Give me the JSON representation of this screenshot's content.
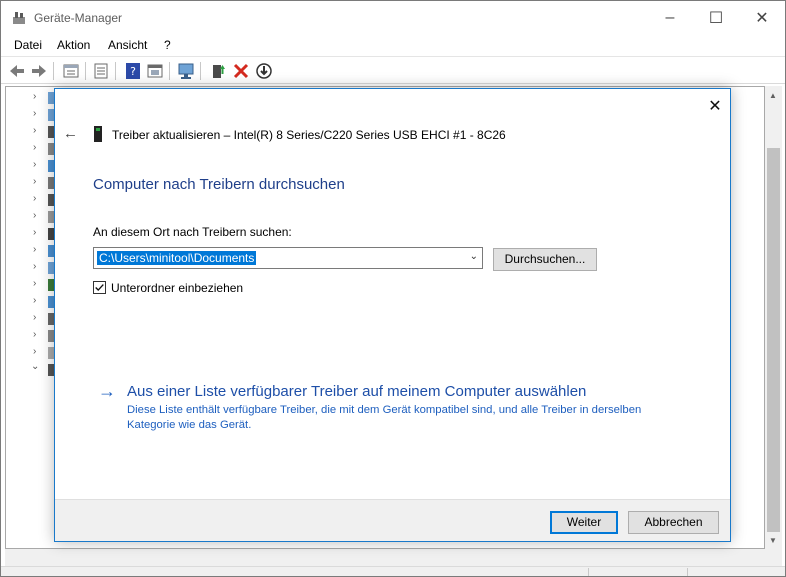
{
  "window": {
    "title": "Geräte-Manager",
    "minimize": "–",
    "maximize": "☐",
    "close": "✕"
  },
  "menu": {
    "items": [
      "Datei",
      "Aktion",
      "Ansicht",
      "?"
    ]
  },
  "toolbar": {
    "icons": [
      "back-arrow-icon",
      "forward-arrow-icon",
      "properties-icon",
      "list-icon",
      "help-icon",
      "view-icon",
      "monitor-icon",
      "add-driver-icon",
      "remove-icon",
      "download-icon"
    ]
  },
  "dialog": {
    "close": "✕",
    "back": "←",
    "title": "Treiber aktualisieren – Intel(R) 8 Series/C220 Series USB EHCI #1 - 8C26",
    "heading": "Computer nach Treibern durchsuchen",
    "path_label": "An diesem Ort nach Treibern suchen:",
    "path_value": "C:\\Users\\minitool\\Documents",
    "browse_label": "Durchsuchen...",
    "subfolder_checked": true,
    "subfolder_label": "Unterordner einbeziehen",
    "pick_arrow": "→",
    "pick_link": "Aus einer Liste verfügbarer Treiber auf meinem Computer auswählen",
    "pick_description": "Diese Liste enthält verfügbare Treiber, die mit dem Gerät kompatibel sind, und alle Treiber in derselben Kategorie wie das Gerät.",
    "next_label": "Weiter",
    "cancel_label": "Abbrechen"
  },
  "colors": {
    "accent": "#0078d7",
    "heading": "#1f3f8a",
    "link": "#1e4fa8"
  }
}
